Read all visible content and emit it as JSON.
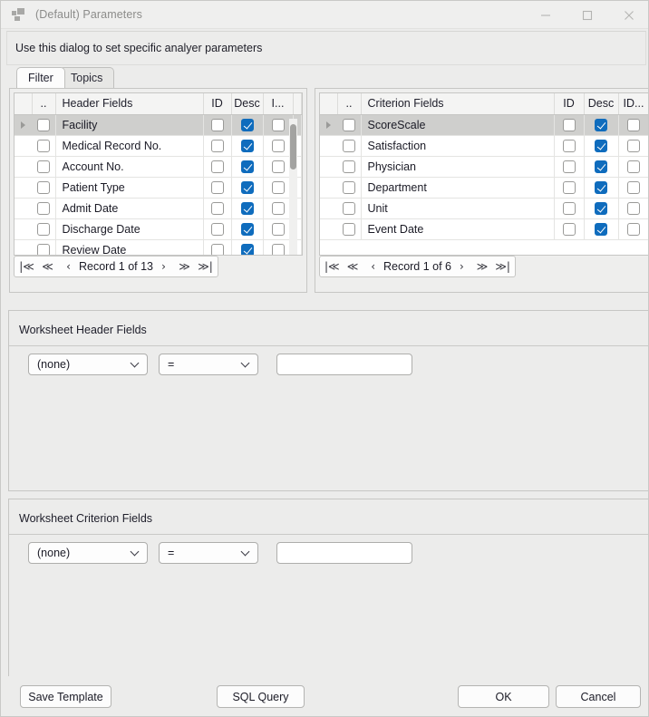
{
  "window": {
    "title": "(Default) Parameters",
    "app_icon": "app-squares-icon",
    "controls": {
      "minimize": "minimize-icon",
      "maximize": "maximize-icon",
      "close": "close-icon"
    }
  },
  "instruction": "Use this dialog to set specific analyer parameters",
  "tabs": [
    {
      "label": "Filter",
      "active": true
    },
    {
      "label": "Topics",
      "active": false
    }
  ],
  "grids": {
    "left": {
      "columns": [
        "",
        "..",
        "Header Fields",
        "ID",
        "Desc",
        "I..."
      ],
      "rows": [
        {
          "name": "Facility",
          "selected": true,
          "id": false,
          "desc": true,
          "i": false
        },
        {
          "name": "Medical Record No.",
          "selected": false,
          "id": false,
          "desc": true,
          "i": false
        },
        {
          "name": "Account No.",
          "selected": false,
          "id": false,
          "desc": true,
          "i": false
        },
        {
          "name": "Patient Type",
          "selected": false,
          "id": false,
          "desc": true,
          "i": false
        },
        {
          "name": "Admit Date",
          "selected": false,
          "id": false,
          "desc": true,
          "i": false
        },
        {
          "name": "Discharge Date",
          "selected": false,
          "id": false,
          "desc": true,
          "i": false
        },
        {
          "name": "Review Date",
          "selected": false,
          "id": false,
          "desc": true,
          "i": false
        }
      ],
      "navigator": {
        "first": "|≪",
        "prev_page": "≪",
        "prev": "‹",
        "label": "Record 1 of 13",
        "next": "›",
        "next_page": "≫",
        "last": "≫|"
      }
    },
    "right": {
      "columns": [
        "",
        "..",
        "Criterion Fields",
        "ID",
        "Desc",
        "ID..."
      ],
      "rows": [
        {
          "name": "ScoreScale",
          "selected": true,
          "id": false,
          "desc": true,
          "i": false
        },
        {
          "name": "Satisfaction",
          "selected": false,
          "id": false,
          "desc": true,
          "i": false
        },
        {
          "name": "Physician",
          "selected": false,
          "id": false,
          "desc": true,
          "i": false
        },
        {
          "name": "Department",
          "selected": false,
          "id": false,
          "desc": true,
          "i": false
        },
        {
          "name": "Unit",
          "selected": false,
          "id": false,
          "desc": true,
          "i": false
        },
        {
          "name": "Event Date",
          "selected": false,
          "id": false,
          "desc": true,
          "i": false
        }
      ],
      "navigator": {
        "first": "|≪",
        "prev_page": "≪",
        "prev": "‹",
        "label": "Record 1 of 6",
        "next": "›",
        "next_page": "≫",
        "last": "≫|"
      }
    }
  },
  "worksheet_header": {
    "title": "Worksheet Header Fields",
    "field_value": "(none)",
    "operator_value": "=",
    "text_value": "",
    "text_placeholder": ""
  },
  "worksheet_criterion": {
    "title": "Worksheet Criterion Fields",
    "field_value": "(none)",
    "operator_value": "=",
    "text_value": "",
    "text_placeholder": ""
  },
  "footer": {
    "save_template": "Save Template",
    "sql_query": "SQL Query",
    "ok": "OK",
    "cancel": "Cancel"
  },
  "colors": {
    "checkbox_checked": "#0f6cbd",
    "window_background": "#ececeb",
    "selected_row": "#cfcfcd"
  }
}
